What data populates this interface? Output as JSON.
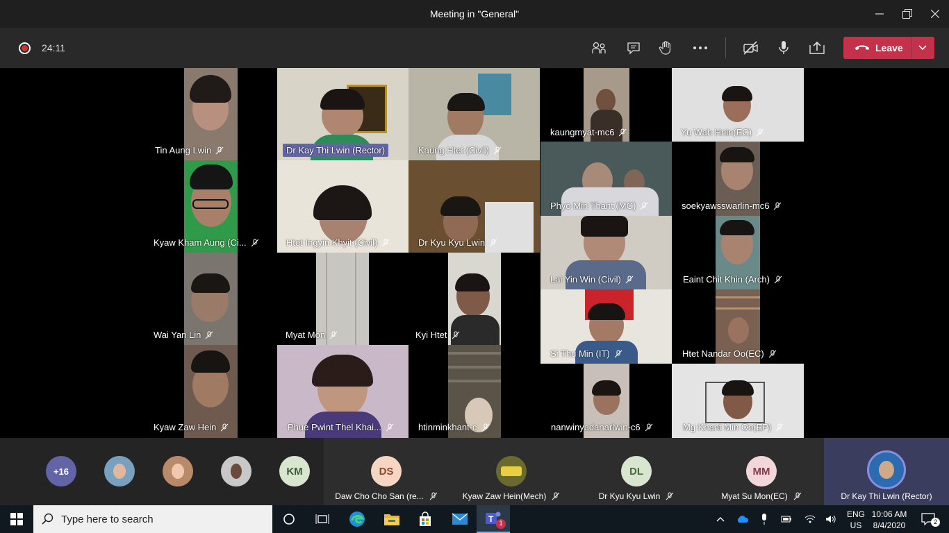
{
  "window": {
    "title": "Meeting in \"General\""
  },
  "toolbar": {
    "timer": "24:11",
    "leave_label": "Leave"
  },
  "tiles": [
    {
      "name": "Tin Aung Lwin",
      "active": false
    },
    {
      "name": "Dr Kay Thi Lwin (Rector)",
      "active": true
    },
    {
      "name": "Kaung Htet (Civil)",
      "active": false
    },
    {
      "name": "kaungmyat-mc6",
      "active": false
    },
    {
      "name": "Yu Wah Hnin(EC)",
      "active": false
    },
    {
      "name": "Kyaw Kham Aung (Ci...",
      "active": false
    },
    {
      "name": "Htet Ingyin Khyit (Civil)",
      "active": false
    },
    {
      "name": "Dr Kyu Kyu Lwin",
      "active": false
    },
    {
      "name": "Phyo Min Thant (MC)",
      "active": false
    },
    {
      "name": "soekyawsswarlin-mc6",
      "active": false
    },
    {
      "name": "Lai Yin Win (Civil)",
      "active": false
    },
    {
      "name": "Eaint Chit Khin (Arch)",
      "active": false
    },
    {
      "name": "Wai Yan Lin",
      "active": false
    },
    {
      "name": "Myat Mon",
      "active": false
    },
    {
      "name": "Kyi Htet",
      "active": false
    },
    {
      "name": "Si Thu Min (IT)",
      "active": false
    },
    {
      "name": "Htet Nandar Oo(EC)",
      "active": false
    },
    {
      "name": "Kyaw Zaw Hein",
      "active": false
    },
    {
      "name": "Phue Pwint Thel Khai...",
      "active": false
    },
    {
      "name": "htinminkhant-c",
      "active": false
    },
    {
      "name": "nanwinyadanarlwin-c6",
      "active": false
    },
    {
      "name": "Mg Khant Min Oo(EP)",
      "active": false
    }
  ],
  "roster": {
    "overflow_count": "+16",
    "initials_km": "KM",
    "cards": [
      {
        "initials": "DS",
        "name": "Daw Cho Cho San (re...",
        "color": "#f6d6c2",
        "text_color": "#8a4a2a"
      },
      {
        "initials": "",
        "name": "Kyaw Zaw Hein(Mech)",
        "color": "#6a6a30",
        "text_color": "#fff"
      },
      {
        "initials": "DL",
        "name": "Dr Kyu Kyu Lwin",
        "color": "#d8e6d0",
        "text_color": "#4a6a40"
      },
      {
        "initials": "MM",
        "name": "Myat Su Mon(EC)",
        "color": "#f3d6da",
        "text_color": "#8a3a4a"
      },
      {
        "initials": "",
        "name": "Dr Kay Thi Lwin (Rector)",
        "color": "#2b6cb0",
        "text_color": "#fff"
      }
    ]
  },
  "taskbar": {
    "search_placeholder": "Type here to search",
    "lang_top": "ENG",
    "lang_bottom": "US",
    "time": "10:06 AM",
    "date": "8/4/2020",
    "notification_count": "2",
    "teams_badge": "1"
  }
}
